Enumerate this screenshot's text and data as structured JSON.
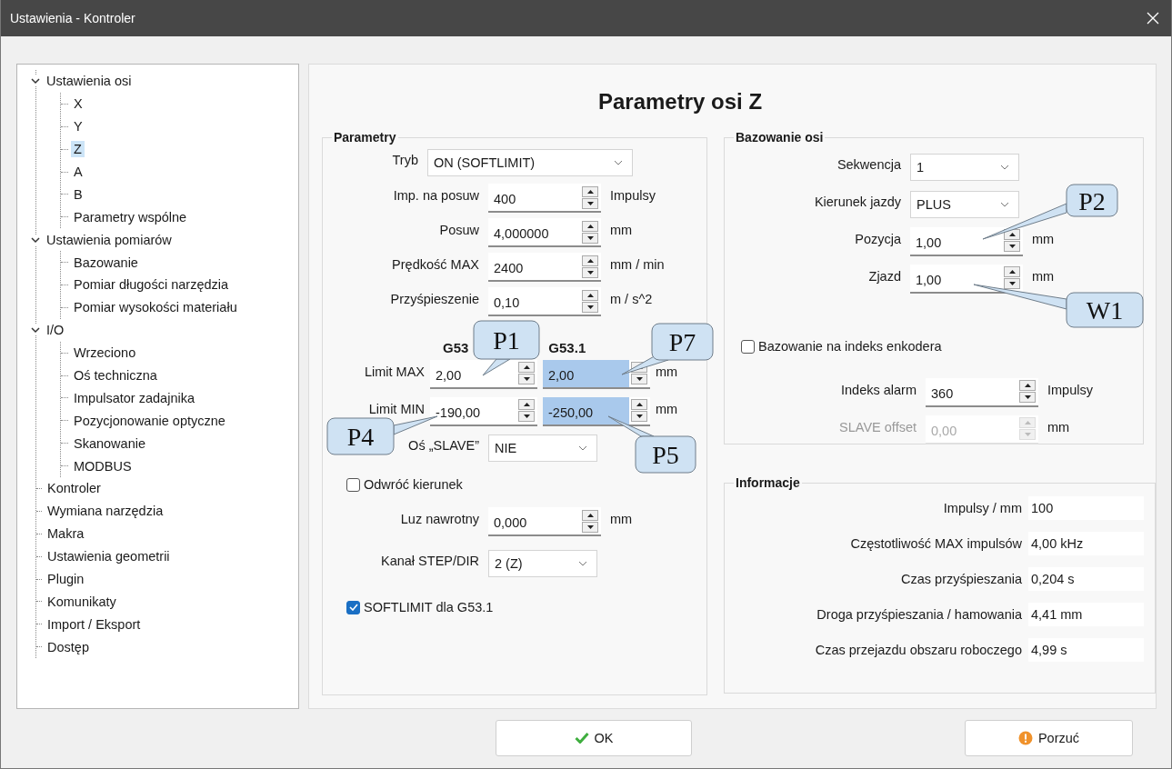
{
  "window": {
    "title": "Ustawienia - Kontroler"
  },
  "tree": [
    {
      "label": "Ustawienia osi",
      "expanded": true,
      "selected": false,
      "children": [
        {
          "label": "X",
          "selected": false
        },
        {
          "label": "Y",
          "selected": false
        },
        {
          "label": "Z",
          "selected": true
        },
        {
          "label": "A",
          "selected": false
        },
        {
          "label": "B",
          "selected": false
        },
        {
          "label": "Parametry wspólne",
          "selected": false
        }
      ]
    },
    {
      "label": "Ustawienia pomiarów",
      "expanded": true,
      "selected": false,
      "children": [
        {
          "label": "Bazowanie",
          "selected": false
        },
        {
          "label": "Pomiar długości narzędzia",
          "selected": false
        },
        {
          "label": "Pomiar wysokości materiału",
          "selected": false
        }
      ]
    },
    {
      "label": "I/O",
      "expanded": true,
      "selected": false,
      "children": [
        {
          "label": "Wrzeciono",
          "selected": false
        },
        {
          "label": "Oś techniczna",
          "selected": false
        },
        {
          "label": "Impulsator zadajnika",
          "selected": false
        },
        {
          "label": "Pozycjonowanie optyczne",
          "selected": false
        },
        {
          "label": "Skanowanie",
          "selected": false
        },
        {
          "label": "MODBUS",
          "selected": false
        }
      ]
    },
    {
      "label": "Kontroler",
      "selected": false
    },
    {
      "label": "Wymiana narzędzia",
      "selected": false
    },
    {
      "label": "Makra",
      "selected": false
    },
    {
      "label": "Ustawienia geometrii",
      "selected": false
    },
    {
      "label": "Plugin",
      "selected": false
    },
    {
      "label": "Komunikaty",
      "selected": false
    },
    {
      "label": "Import / Eksport",
      "selected": false
    },
    {
      "label": "Dostęp",
      "selected": false
    }
  ],
  "page_title": "Parametry osi Z",
  "parameters": {
    "title": "Parametry",
    "rows": [
      {
        "kind": "combo",
        "label": "Tryb",
        "value": "ON (SOFTLIMIT)"
      },
      {
        "kind": "spin",
        "label": "Imp. na posuw",
        "value": "400",
        "unit": "Impulsy"
      },
      {
        "kind": "spin",
        "label": "Posuw",
        "value": "4,000000",
        "unit": "mm"
      },
      {
        "kind": "spin",
        "label": "Prędkość MAX",
        "value": "2400",
        "unit": "mm / min"
      },
      {
        "kind": "spin",
        "label": "Przyśpieszenie",
        "value": "0,10",
        "unit": "m / s^2"
      },
      {
        "kind": "header",
        "columns": [
          "G53",
          "G53.1"
        ]
      },
      {
        "kind": "limit",
        "label": "Limit MAX",
        "unit": "mm",
        "fields": [
          {
            "value": "2,00",
            "highlighted": false
          },
          {
            "value": "2,00",
            "highlighted": true
          }
        ]
      },
      {
        "kind": "limit",
        "label": "Limit MIN",
        "unit": "mm",
        "fields": [
          {
            "value": "-190,00",
            "highlighted": false
          },
          {
            "value": "-250,00",
            "highlighted": true
          }
        ]
      },
      {
        "kind": "combo",
        "label": "Oś „SLAVE”",
        "value": "NIE"
      },
      {
        "kind": "check",
        "label": "Odwróć kierunek",
        "checked": false
      },
      {
        "kind": "spin",
        "label": "Luz nawrotny",
        "value": "0,000",
        "unit": "mm"
      },
      {
        "kind": "combo",
        "label": "Kanał STEP/DIR",
        "value": "2 (Z)"
      },
      {
        "kind": "check",
        "label": "SOFTLIMIT dla G53.1",
        "checked": true
      }
    ]
  },
  "homing": {
    "title": "Bazowanie osi",
    "rows": [
      {
        "kind": "combo",
        "label": "Sekwencja",
        "value": "1",
        "disabled": false
      },
      {
        "kind": "combo",
        "label": "Kierunek jazdy",
        "value": "PLUS",
        "disabled": false
      },
      {
        "kind": "spin",
        "label": "Pozycja",
        "value": "1,00",
        "unit": "mm",
        "disabled": false
      },
      {
        "kind": "spin",
        "label": "Zjazd",
        "value": "1,00",
        "unit": "mm",
        "disabled": false
      },
      {
        "kind": "check",
        "label": "Bazowanie na indeks enkodera",
        "checked": false,
        "disabled": false
      },
      {
        "kind": "spin",
        "label": "Indeks alarm",
        "value": "360",
        "unit": "Impulsy",
        "disabled": false
      },
      {
        "kind": "spin",
        "label": "SLAVE offset",
        "value": "0,00",
        "unit": "mm",
        "disabled": true
      }
    ]
  },
  "info": {
    "title": "Informacje",
    "rows": [
      {
        "label": "Impulsy / mm",
        "value": "100"
      },
      {
        "label": "Częstotliwość MAX impulsów",
        "value": "4,00 kHz"
      },
      {
        "label": "Czas przyśpieszania",
        "value": "0,204 s"
      },
      {
        "label": "Droga przyśpieszania / hamowania",
        "value": "4,41 mm"
      },
      {
        "label": "Czas przejazdu obszaru roboczego",
        "value": "4,99 s"
      }
    ]
  },
  "callouts": [
    {
      "label": "P1"
    },
    {
      "label": "P7"
    },
    {
      "label": "P2"
    },
    {
      "label": "W1"
    },
    {
      "label": "P4"
    },
    {
      "label": "P5"
    }
  ],
  "buttons": [
    {
      "kind": "ok",
      "label": "OK"
    },
    {
      "kind": "cancel",
      "label": "Porzuć"
    }
  ]
}
